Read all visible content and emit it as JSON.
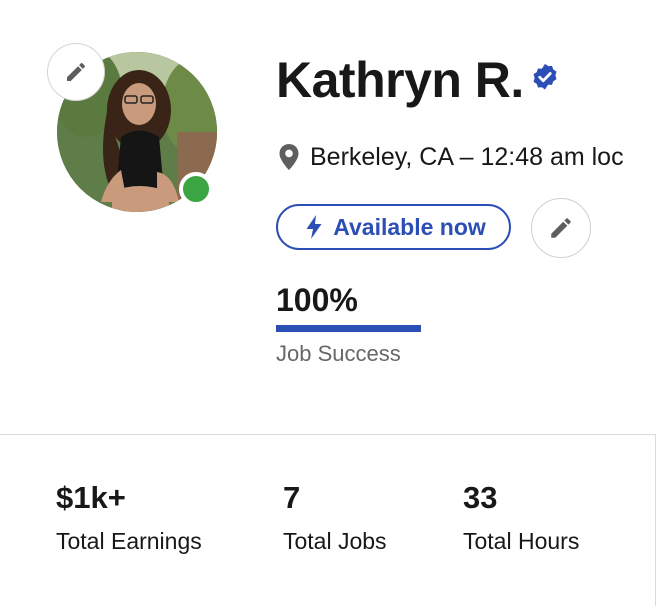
{
  "profile": {
    "name": "Kathryn R.",
    "verified_icon": "verified-badge-icon",
    "location": "Berkeley, CA – 12:48 am loc",
    "online_status_color": "#3ba543",
    "availability_label": "Available now",
    "job_success": {
      "value": "100%",
      "fraction": 1.0,
      "label": "Job Success"
    }
  },
  "stats": [
    {
      "value": "$1k+",
      "label": "Total Earnings"
    },
    {
      "value": "7",
      "label": "Total Jobs"
    },
    {
      "value": "33",
      "label": "Total Hours"
    }
  ],
  "colors": {
    "accent": "#2c4fb5",
    "online": "#3ba543",
    "border": "#dadada"
  }
}
